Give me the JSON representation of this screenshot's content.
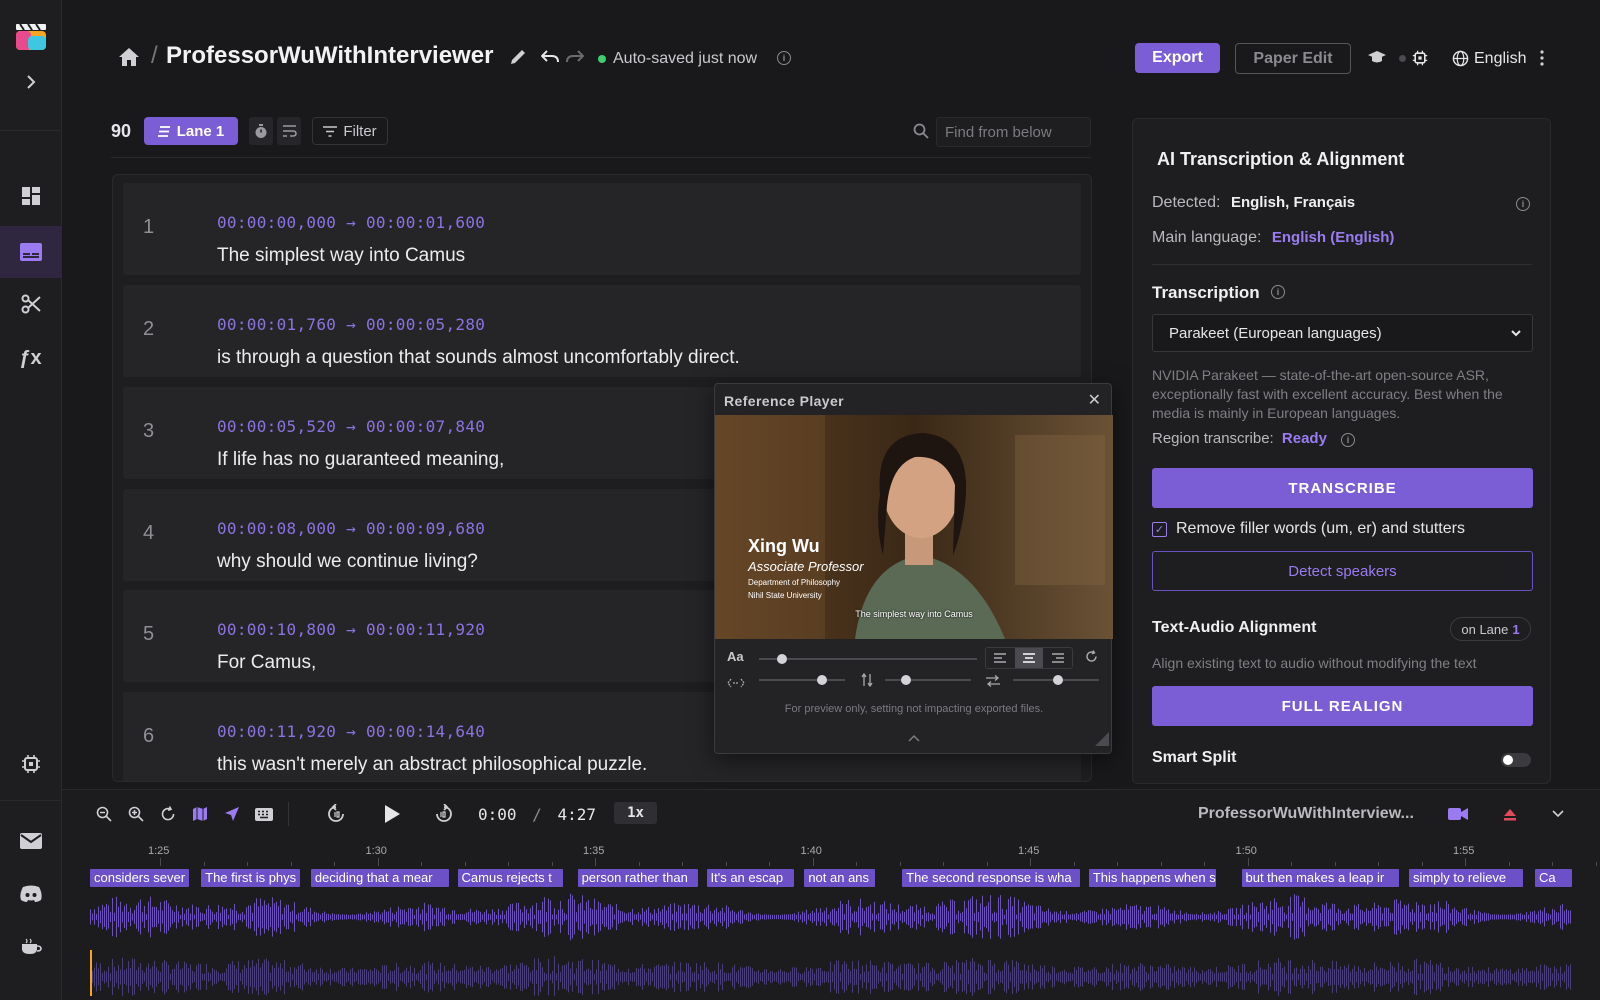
{
  "rail": {
    "items": [
      {
        "name": "dashboard",
        "icon": "dashboard-icon"
      },
      {
        "name": "subtitles",
        "icon": "subtitles-icon",
        "active": true
      },
      {
        "name": "cut",
        "icon": "scissors-icon"
      },
      {
        "name": "effects",
        "icon": "fx-icon"
      },
      {
        "name": "settings",
        "icon": "chip-icon"
      },
      {
        "name": "mail",
        "icon": "mail-icon"
      },
      {
        "name": "discord",
        "icon": "discord-icon"
      },
      {
        "name": "coffee",
        "icon": "coffee-icon"
      }
    ],
    "fx_label": "ƒx"
  },
  "header": {
    "separator": "/",
    "title": "ProfessorWuWithInterviewer",
    "autosave": "Auto-saved just now",
    "export_label": "Export",
    "paper_edit_label": "Paper Edit",
    "language": "English"
  },
  "toolbar": {
    "count": "90",
    "lane_label": "Lane 1",
    "filter_label": "Filter",
    "find_placeholder": "Find from below"
  },
  "subtitles": [
    {
      "index": "1",
      "timecode": "00:00:00,000 → 00:00:01,600",
      "text": "The simplest way into Camus"
    },
    {
      "index": "2",
      "timecode": "00:00:01,760 → 00:00:05,280",
      "text": "is through a question that sounds almost uncomfortably direct."
    },
    {
      "index": "3",
      "timecode": "00:00:05,520 → 00:00:07,840",
      "text": "If life has no guaranteed meaning,"
    },
    {
      "index": "4",
      "timecode": "00:00:08,000 → 00:00:09,680",
      "text": "why should we continue living?"
    },
    {
      "index": "5",
      "timecode": "00:00:10,800 → 00:00:11,920",
      "text": "For Camus,"
    },
    {
      "index": "6",
      "timecode": "00:00:11,920 → 00:00:14,640",
      "text": "this wasn't merely an abstract philosophical puzzle."
    }
  ],
  "player": {
    "title": "Reference Player",
    "close": "✕",
    "name": "Xing Wu",
    "role": "Associate Professor",
    "dept": "Department of Philosophy",
    "university": "Nihil State University",
    "subtitle": "The simplest way into Camus",
    "font_label": "Aa",
    "note": "For preview only, setting not impacting exported files."
  },
  "panel": {
    "title": "AI Transcription & Alignment",
    "detected_label": "Detected:",
    "detected_value": "English, Français",
    "main_lang_label": "Main language:",
    "main_lang_value": "English (English)",
    "transcription_heading": "Transcription",
    "model": "Parakeet (European languages)",
    "model_desc": "NVIDIA Parakeet — state-of-the-art open-source ASR, exceptionally fast with excellent accuracy. Best when the media is mainly in European languages.",
    "region_label": "Region transcribe:",
    "region_value": "Ready",
    "transcribe_label": "TRANSCRIBE",
    "filler_label": "Remove filler words (um, er) and stutters",
    "filler_checked": "✓",
    "detect_label": "Detect speakers",
    "alignment_heading": "Text-Audio Alignment",
    "lane_badge_prefix": "on Lane",
    "lane_badge_num": "1",
    "alignment_desc": "Align existing text to audio without modifying the text",
    "realign_label": "FULL REALIGN",
    "smart_split_heading": "Smart Split"
  },
  "transport": {
    "current": "0:00",
    "sep": "/",
    "total": "4:27",
    "speed": "1x",
    "media_name": "ProfessorWuWithInterview...",
    "ruler": [
      "1:25",
      "1:30",
      "1:35",
      "1:40",
      "1:45",
      "1:50",
      "1:55"
    ],
    "cues": [
      {
        "text": "considers sever",
        "start": 0.0,
        "end": 0.067
      },
      {
        "text": "The first is phys",
        "start": 0.075,
        "end": 0.142
      },
      {
        "text": "deciding that a mear",
        "start": 0.149,
        "end": 0.242
      },
      {
        "text": "Camus rejects t",
        "start": 0.248,
        "end": 0.319
      },
      {
        "text": "person rather than",
        "start": 0.329,
        "end": 0.41
      },
      {
        "text": "It's an escap",
        "start": 0.416,
        "end": 0.475
      },
      {
        "text": "not an ans",
        "start": 0.482,
        "end": 0.53
      },
      {
        "text": "The second response is wha",
        "start": 0.548,
        "end": 0.668
      },
      {
        "text": "This happens when s",
        "start": 0.674,
        "end": 0.76
      },
      {
        "text": "but then makes a leap ir",
        "start": 0.777,
        "end": 0.883
      },
      {
        "text": "simply to relieve",
        "start": 0.89,
        "end": 0.967
      },
      {
        "text": "Ca",
        "start": 0.975,
        "end": 1.0
      }
    ]
  },
  "colors": {
    "accent": "#7b5ed6",
    "accent_text": "#9a7cf0",
    "ok": "#3ccf6e",
    "record": "#e04a5a"
  }
}
